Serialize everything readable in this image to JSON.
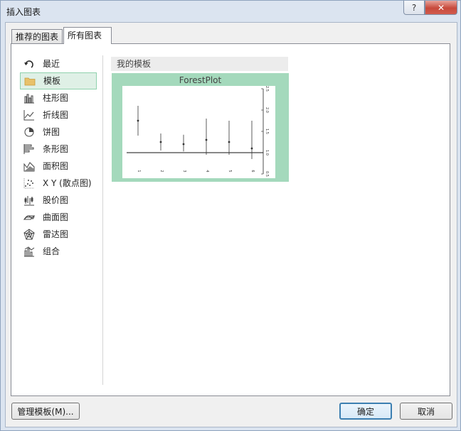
{
  "window": {
    "title": "插入图表",
    "help_label": "?",
    "close_label": "✕"
  },
  "tabs": [
    {
      "label": "推荐的图表",
      "active": false
    },
    {
      "label": "所有图表",
      "active": true
    }
  ],
  "sidebar": {
    "items": [
      {
        "label": "最近",
        "icon": "undo-arrow-icon",
        "selected": false
      },
      {
        "label": "模板",
        "icon": "folder-icon",
        "selected": true
      },
      {
        "label": "柱形图",
        "icon": "column-chart-icon",
        "selected": false
      },
      {
        "label": "折线图",
        "icon": "line-chart-icon",
        "selected": false
      },
      {
        "label": "饼图",
        "icon": "pie-chart-icon",
        "selected": false
      },
      {
        "label": "条形图",
        "icon": "bar-chart-icon",
        "selected": false
      },
      {
        "label": "面积图",
        "icon": "area-chart-icon",
        "selected": false
      },
      {
        "label": "X Y (散点图)",
        "icon": "scatter-chart-icon",
        "selected": false
      },
      {
        "label": "股价图",
        "icon": "stock-chart-icon",
        "selected": false
      },
      {
        "label": "曲面图",
        "icon": "surface-chart-icon",
        "selected": false
      },
      {
        "label": "雷达图",
        "icon": "radar-chart-icon",
        "selected": false
      },
      {
        "label": "组合",
        "icon": "combo-chart-icon",
        "selected": false
      }
    ]
  },
  "templates": {
    "header": "我的模板",
    "items": [
      {
        "name": "ForestPlot"
      }
    ]
  },
  "buttons": {
    "manage": "管理模板(M)...",
    "ok": "确定",
    "cancel": "取消"
  },
  "colors": {
    "selected_bg": "#dff0e6",
    "selected_border": "#8fd1ad",
    "thumb_bg": "#a4d9bc",
    "ok_border": "#3c7fb1"
  },
  "chart_data": {
    "type": "scatter",
    "title": "ForestPlot",
    "x": [
      1,
      2,
      3,
      4,
      5,
      6
    ],
    "x_tick_labels": [
      "1",
      "2",
      "3",
      "4",
      "5",
      "6"
    ],
    "point": [
      1.75,
      1.25,
      1.2,
      1.3,
      1.25,
      1.1
    ],
    "ci_low": [
      1.4,
      1.05,
      1.03,
      0.95,
      0.95,
      0.85
    ],
    "ci_high": [
      2.1,
      1.45,
      1.42,
      1.8,
      1.75,
      1.75
    ],
    "reference_line": 1.0,
    "y_ticks": [
      0.5,
      1.0,
      1.5,
      2.0,
      2.5
    ],
    "y_tick_labels": [
      "0.5",
      "1.0",
      "1.5",
      "2.0",
      "2.5"
    ],
    "ylim": [
      0.5,
      2.5
    ],
    "y_axis_side": "right"
  }
}
